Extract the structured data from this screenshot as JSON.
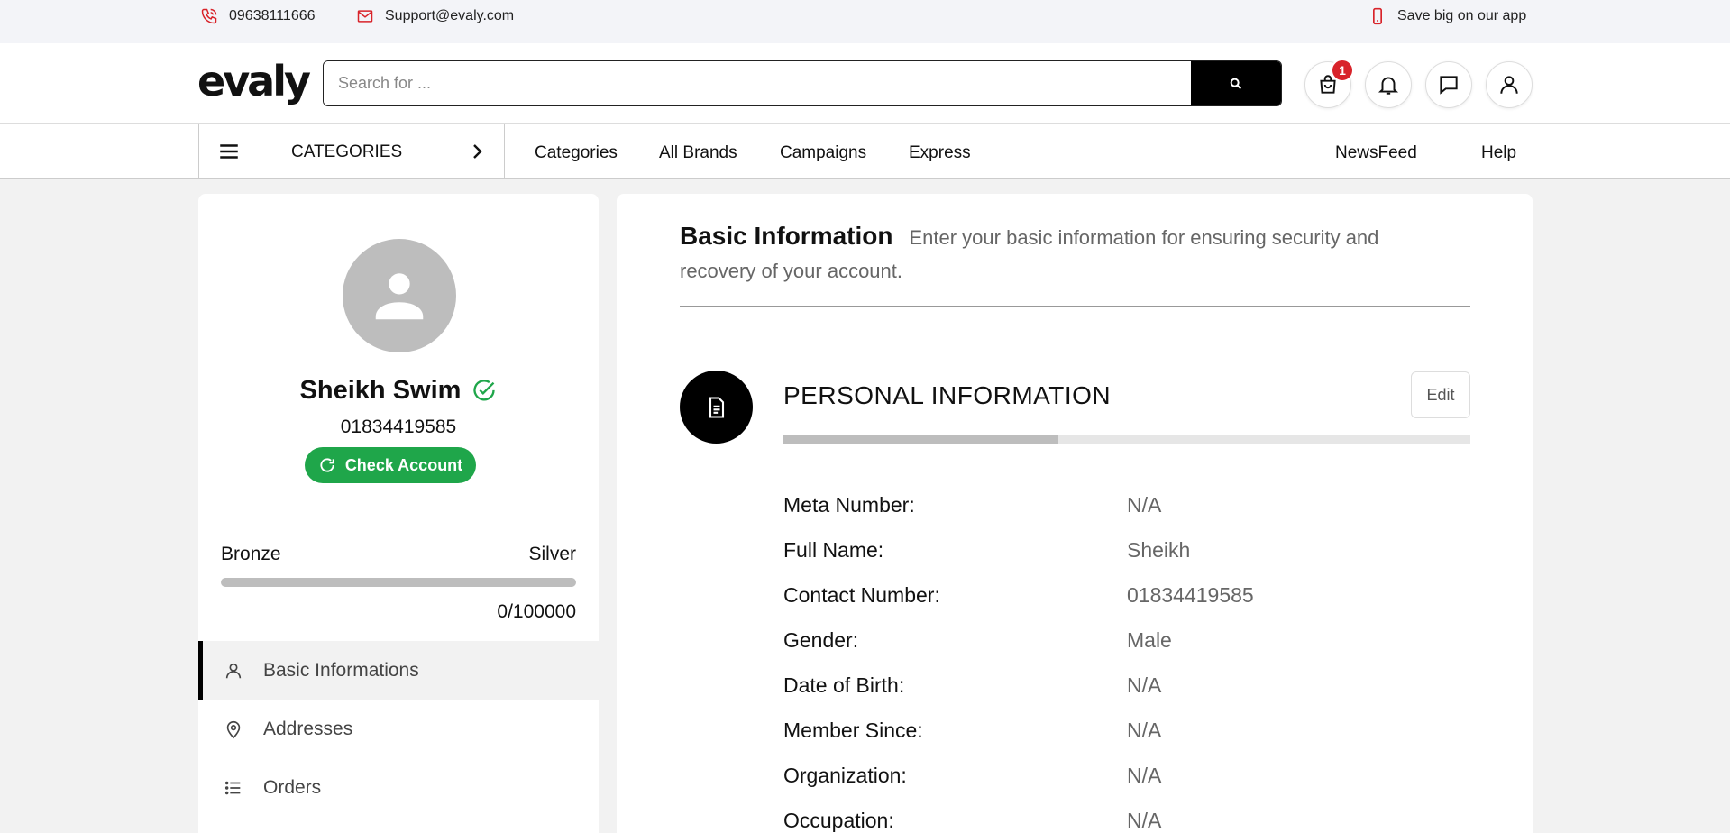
{
  "topbar": {
    "phone": "09638111666",
    "email": "Support@evaly.com",
    "app_promo": "Save big on our app"
  },
  "header": {
    "logo": "evaly",
    "search_placeholder": "Search for ...",
    "cart_count": "1"
  },
  "nav": {
    "categories_label": "CATEGORIES",
    "links": [
      "Categories",
      "All Brands",
      "Campaigns",
      "Express"
    ],
    "right_links": [
      "NewsFeed",
      "Help"
    ]
  },
  "profile": {
    "name": "Sheikh Swim",
    "phone": "01834419585",
    "check_button": "Check Account",
    "tier_current": "Bronze",
    "tier_next": "Silver",
    "points": "0/100000",
    "tier_progress": 0,
    "menu": [
      {
        "label": "Basic Informations",
        "icon": "user-icon",
        "active": true
      },
      {
        "label": "Addresses",
        "icon": "location-pin-icon",
        "active": false
      },
      {
        "label": "Orders",
        "icon": "list-icon",
        "active": false
      }
    ]
  },
  "basic_info": {
    "title": "Basic Information",
    "description": "Enter your basic information for ensuring security and recovery of your account.",
    "section_title": "PERSONAL INFORMATION",
    "edit_label": "Edit",
    "completion": 0.4,
    "fields": [
      {
        "label": "Meta Number:",
        "value": "N/A"
      },
      {
        "label": "Full Name:",
        "value": "Sheikh"
      },
      {
        "label": "Contact Number:",
        "value": "01834419585"
      },
      {
        "label": "Gender:",
        "value": "Male"
      },
      {
        "label": "Date of Birth:",
        "value": "N/A"
      },
      {
        "label": "Member Since:",
        "value": "N/A"
      },
      {
        "label": "Organization:",
        "value": "N/A"
      },
      {
        "label": "Occupation:",
        "value": "N/A"
      }
    ]
  },
  "colors": {
    "accent_red": "#d8232a",
    "verified_green": "#1fa64a"
  }
}
